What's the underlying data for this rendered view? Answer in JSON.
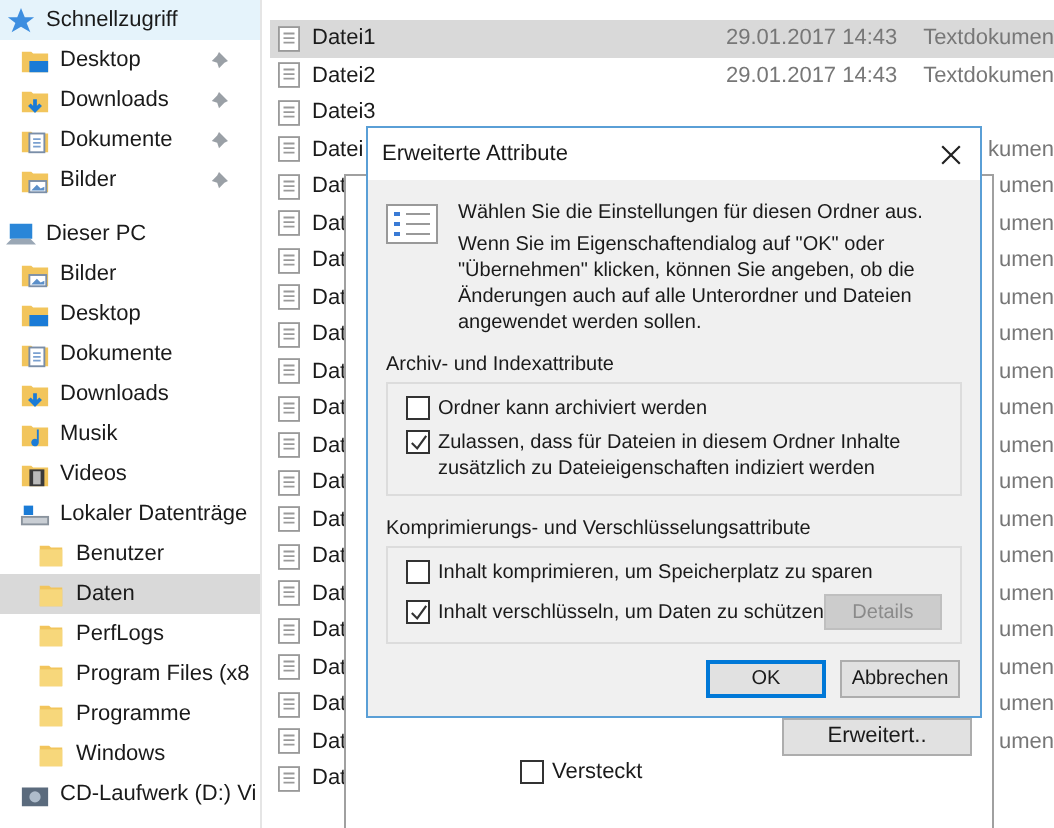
{
  "sidebar": {
    "items": [
      {
        "label": "Schnellzugriff",
        "kind": "star",
        "hovered": true,
        "selected": false,
        "children": [
          {
            "label": "Desktop",
            "kind": "desktop",
            "pinned": true,
            "hovered": false,
            "selected": false
          },
          {
            "label": "Downloads",
            "kind": "download",
            "pinned": true,
            "hovered": false,
            "selected": false
          },
          {
            "label": "Dokumente",
            "kind": "document",
            "pinned": true,
            "hovered": false,
            "selected": false
          },
          {
            "label": "Bilder",
            "kind": "image",
            "pinned": true,
            "hovered": false,
            "selected": false
          }
        ]
      },
      {
        "label": "Dieser PC",
        "kind": "pc",
        "hovered": false,
        "selected": false,
        "children": [
          {
            "label": "Bilder",
            "kind": "image",
            "hovered": false,
            "selected": false
          },
          {
            "label": "Desktop",
            "kind": "desktop",
            "hovered": false,
            "selected": false
          },
          {
            "label": "Dokumente",
            "kind": "document",
            "hovered": false,
            "selected": false
          },
          {
            "label": "Downloads",
            "kind": "download",
            "hovered": false,
            "selected": false
          },
          {
            "label": "Musik",
            "kind": "music",
            "hovered": false,
            "selected": false
          },
          {
            "label": "Videos",
            "kind": "video",
            "hovered": false,
            "selected": false
          },
          {
            "label": "Lokaler Datenträge",
            "kind": "drive",
            "hovered": false,
            "selected": false,
            "children": [
              {
                "label": "Benutzer",
                "kind": "folder",
                "hovered": false,
                "selected": false
              },
              {
                "label": "Daten",
                "kind": "folder",
                "hovered": false,
                "selected": true
              },
              {
                "label": "PerfLogs",
                "kind": "folder",
                "hovered": false,
                "selected": false
              },
              {
                "label": "Program Files (x8",
                "kind": "folder",
                "hovered": false,
                "selected": false
              },
              {
                "label": "Programme",
                "kind": "folder",
                "hovered": false,
                "selected": false
              },
              {
                "label": "Windows",
                "kind": "folder",
                "hovered": false,
                "selected": false
              }
            ]
          },
          {
            "label": "CD-Laufwerk (D:) Vi",
            "kind": "cd",
            "hovered": false,
            "selected": false
          }
        ]
      }
    ]
  },
  "files": [
    {
      "name": "Datei1",
      "date": "29.01.2017 14:43",
      "type": "Textdokumen",
      "selected": true
    },
    {
      "name": "Datei2",
      "date": "29.01.2017 14:43",
      "type": "Textdokumen",
      "selected": false
    },
    {
      "name": "Datei3",
      "selected": false
    },
    {
      "name": "Datei",
      "type": "kumen",
      "selected": false
    },
    {
      "name": "Dat",
      "type": "umen",
      "selected": false
    },
    {
      "name": "Dat",
      "type": "umen",
      "selected": false
    },
    {
      "name": "Dat",
      "type": "umen",
      "selected": false
    },
    {
      "name": "Dat",
      "type": "umen",
      "selected": false
    },
    {
      "name": "Dat",
      "type": "umen",
      "selected": false
    },
    {
      "name": "Dat",
      "type": "umen",
      "selected": false
    },
    {
      "name": "Dat",
      "type": "umen",
      "selected": false
    },
    {
      "name": "Dat",
      "type": "umen",
      "selected": false
    },
    {
      "name": "Dat",
      "type": "umen",
      "selected": false
    },
    {
      "name": "Dat",
      "type": "umen",
      "selected": false
    },
    {
      "name": "Dat",
      "type": "umen",
      "selected": false
    },
    {
      "name": "Dat",
      "type": "umen",
      "selected": false
    },
    {
      "name": "Dat",
      "type": "umen",
      "selected": false
    },
    {
      "name": "Dat",
      "type": "umen",
      "selected": false
    },
    {
      "name": "Dat",
      "type": "umen",
      "selected": false
    },
    {
      "name": "Dat",
      "type": "umen",
      "selected": false
    },
    {
      "name": "Dat",
      "selected": false
    }
  ],
  "properties_window": {
    "hidden_option": {
      "label": "Versteckt",
      "checked": false
    },
    "advanced_button": "Erweitert.."
  },
  "dialog": {
    "title": "Erweiterte Attribute",
    "intro": "Wählen Sie die Einstellungen für diesen Ordner aus.",
    "description": "Wenn Sie im Eigenschaftendialog auf \"OK\" oder \"Übernehmen\" klicken, können Sie angeben, ob die Änderungen auch auf alle Unterordner und Dateien angewendet werden sollen.",
    "groups": [
      {
        "title": "Archiv- und Indexattribute",
        "options": [
          {
            "label": "Ordner kann archiviert werden",
            "checked": false
          },
          {
            "label": "Zulassen, dass für Dateien in diesem Ordner Inhalte zusätzlich zu Dateieigenschaften indiziert werden",
            "checked": true
          }
        ]
      },
      {
        "title": "Komprimierungs- und Verschlüsselungsattribute",
        "options": [
          {
            "label": "Inhalt komprimieren, um Speicherplatz zu sparen",
            "checked": false
          },
          {
            "label": "Inhalt verschlüsseln, um Daten zu schützen",
            "checked": true
          }
        ]
      }
    ],
    "details_button": {
      "label": "Details",
      "disabled": true
    },
    "buttons": [
      {
        "label": "OK",
        "default": true
      },
      {
        "label": "Abbrechen",
        "default": false
      }
    ]
  }
}
